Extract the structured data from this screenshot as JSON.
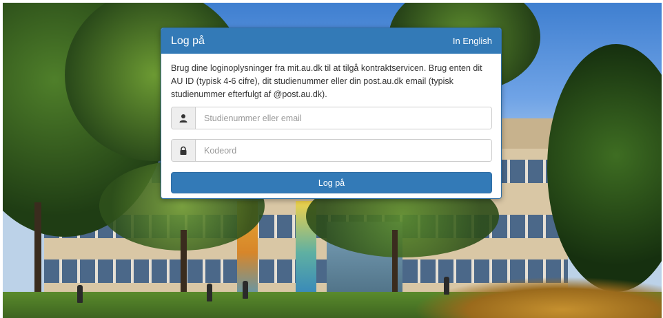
{
  "panel": {
    "title": "Log på",
    "language_link": "In English",
    "intro": "Brug dine loginoplysninger fra mit.au.dk til at tilgå kontraktservicen. Brug enten dit AU ID (typisk 4-6 cifre), dit studienummer eller din post.au.dk email (typisk studienummer efterfulgt af @post.au.dk).",
    "username": {
      "placeholder": "Studienummer eller email",
      "value": "",
      "icon": "user-icon"
    },
    "password": {
      "placeholder": "Kodeord",
      "value": "",
      "icon": "lock-icon"
    },
    "submit_label": "Log på"
  },
  "colors": {
    "primary": "#337ab7",
    "addon_bg": "#eeeeee",
    "border": "#cccccc"
  }
}
